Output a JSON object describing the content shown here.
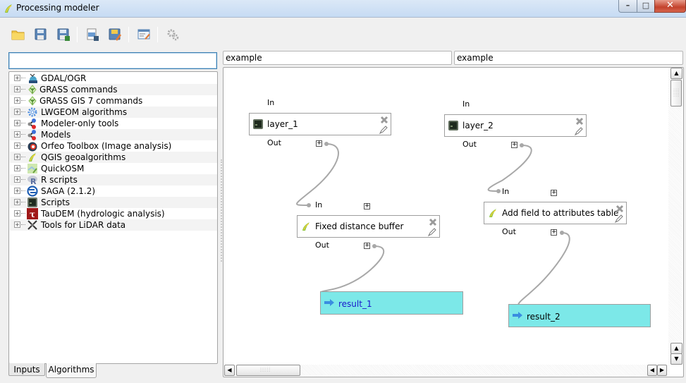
{
  "window": {
    "title": "Processing modeler",
    "controls": {
      "minimize": "–",
      "maximize": "□",
      "close": "✕"
    }
  },
  "toolbar": {
    "buttons": [
      {
        "name": "open-model-button",
        "icon": "folder-icon"
      },
      {
        "name": "save-model-button",
        "icon": "save-icon"
      },
      {
        "name": "save-as-button",
        "icon": "save-as-icon"
      },
      {
        "name": "export-image-button",
        "icon": "export-image-icon"
      },
      {
        "name": "export-python-button",
        "icon": "export-python-icon"
      },
      {
        "name": "edit-help-button",
        "icon": "edit-help-icon"
      },
      {
        "name": "run-model-button",
        "icon": "gears-icon"
      }
    ]
  },
  "left_panel": {
    "search": {
      "value": "",
      "placeholder": ""
    },
    "tree": [
      {
        "label": "GDAL/OGR",
        "icon": "gdal-icon"
      },
      {
        "label": "GRASS commands",
        "icon": "grass-icon"
      },
      {
        "label": "GRASS GIS 7 commands",
        "icon": "grass-icon"
      },
      {
        "label": "LWGEOM algorithms",
        "icon": "gear-icon"
      },
      {
        "label": "Modeler-only tools",
        "icon": "model-icon"
      },
      {
        "label": "Models",
        "icon": "model-icon"
      },
      {
        "label": "Orfeo Toolbox (Image analysis)",
        "icon": "orfeo-icon"
      },
      {
        "label": "QGIS geoalgorithms",
        "icon": "qgis-icon"
      },
      {
        "label": "QuickOSM",
        "icon": "quickosm-icon"
      },
      {
        "label": "R scripts",
        "icon": "r-icon"
      },
      {
        "label": "SAGA (2.1.2)",
        "icon": "saga-icon"
      },
      {
        "label": "Scripts",
        "icon": "script-icon"
      },
      {
        "label": "TauDEM (hydrologic analysis)",
        "icon": "taudem-icon"
      },
      {
        "label": "Tools for LiDAR data",
        "icon": "lidar-icon"
      }
    ],
    "tabs": [
      {
        "label": "Inputs",
        "active": false
      },
      {
        "label": "Algorithms",
        "active": true
      }
    ]
  },
  "model": {
    "name": "example",
    "group": "example"
  },
  "canvas": {
    "nodes": {
      "layer_1": {
        "label": "layer_1",
        "in": "In",
        "out": "Out",
        "type": "input"
      },
      "layer_2": {
        "label": "layer_2",
        "in": "In",
        "out": "Out",
        "type": "input"
      },
      "buffer": {
        "label": "Fixed distance buffer",
        "in": "In",
        "out": "Out",
        "type": "algorithm"
      },
      "addfield": {
        "label": "Add field to attributes table",
        "in": "In",
        "out": "Out",
        "type": "algorithm"
      },
      "result_1": {
        "label": "result_1",
        "type": "output",
        "color": "#1a1acc"
      },
      "result_2": {
        "label": "result_2",
        "type": "output",
        "color": "#000000"
      }
    },
    "port_toggle": "+",
    "output_fill": "#7ce8e8"
  }
}
